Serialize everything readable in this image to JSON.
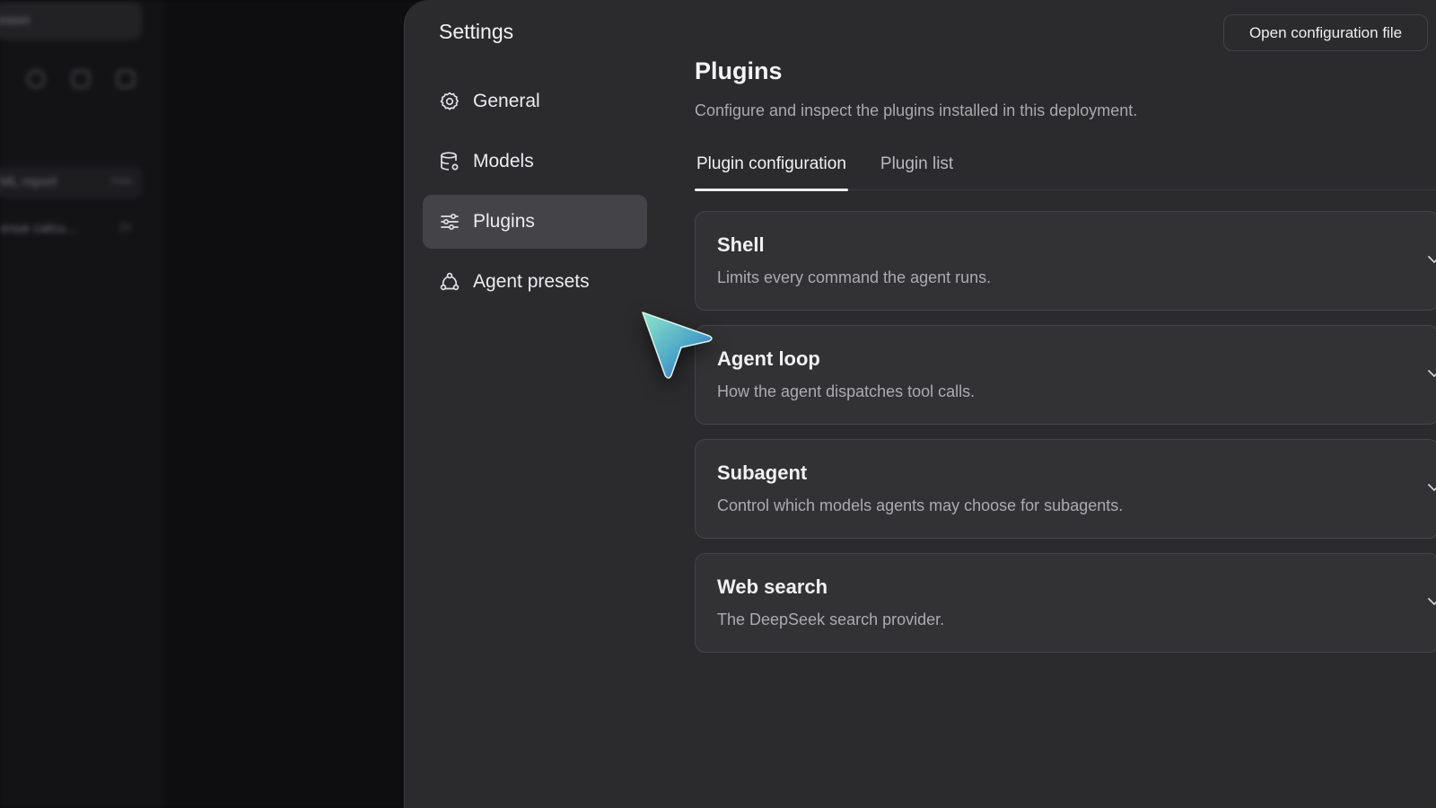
{
  "background_app": {
    "top_button": "ssion",
    "items": [
      {
        "label": "ML report",
        "meta": "now"
      },
      {
        "label": "enue calcu...",
        "meta": "1h"
      }
    ]
  },
  "settings": {
    "title": "Settings",
    "open_config_label": "Open configuration file",
    "nav": [
      {
        "label": "General",
        "icon": "gear-icon"
      },
      {
        "label": "Models",
        "icon": "database-icon"
      },
      {
        "label": "Plugins",
        "icon": "sliders-icon",
        "active": true
      },
      {
        "label": "Agent presets",
        "icon": "agents-icon"
      }
    ]
  },
  "main": {
    "title": "Plugins",
    "description": "Configure and inspect the plugins installed in this deployment.",
    "tabs": [
      {
        "label": "Plugin configuration",
        "active": true
      },
      {
        "label": "Plugin list",
        "active": false
      }
    ],
    "plugins": [
      {
        "title": "Shell",
        "description": "Limits every command the agent runs."
      },
      {
        "title": "Agent loop",
        "description": "How the agent dispatches tool calls."
      },
      {
        "title": "Subagent",
        "description": "Control which models agents may choose for subagents."
      },
      {
        "title": "Web search",
        "description": "The DeepSeek search provider."
      }
    ]
  },
  "colors": {
    "window_bg": "#2b2b2e",
    "card_bg": "#323235",
    "active_nav_bg": "#434348",
    "cursor_gradient": [
      "#7fe0c8",
      "#3b6fd8"
    ]
  }
}
